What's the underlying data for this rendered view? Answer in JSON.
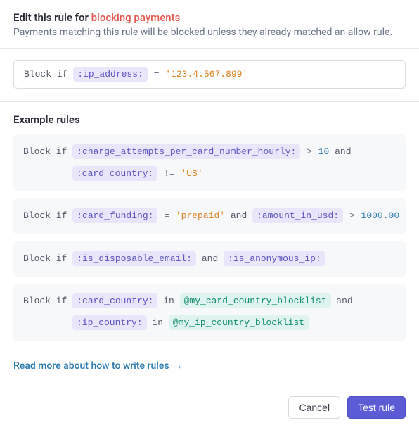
{
  "header": {
    "title_prefix": "Edit this rule for ",
    "title_accent": "blocking payments",
    "subtitle": "Payments matching this rule will be blocked unless they already matched an allow rule."
  },
  "rule": {
    "prefix": "Block if ",
    "attr": ":ip_address:",
    "op": " = ",
    "value": "'123.4.567.899'"
  },
  "examples_title": "Example rules",
  "examples": {
    "ex1": {
      "prefix": "Block if ",
      "attr1": ":charge_attempts_per_card_number_hourly:",
      "op1": " > ",
      "num1": "10",
      "and1": " and",
      "attr2": ":card_country:",
      "op2": " != ",
      "str2": "'US'"
    },
    "ex2": {
      "prefix": "Block if ",
      "attr1": ":card_funding:",
      "op1": " = ",
      "str1": "'prepaid'",
      "and1": " and ",
      "attr2": ":amount_in_usd:",
      "op2": " > ",
      "num2": "1000.00"
    },
    "ex3": {
      "prefix": "Block if ",
      "attr1": ":is_disposable_email:",
      "and1": " and ",
      "attr2": ":is_anonymous_ip:"
    },
    "ex4": {
      "prefix": "Block if ",
      "attr1": ":card_country:",
      "in1": " in ",
      "list1": "@my_card_country_blocklist",
      "and1": " and",
      "attr2": ":ip_country:",
      "in2": " in ",
      "list2": "@my_ip_country_blocklist"
    }
  },
  "read_more": "Read more about how to write rules",
  "arrow": "→",
  "buttons": {
    "cancel": "Cancel",
    "test": "Test rule"
  }
}
